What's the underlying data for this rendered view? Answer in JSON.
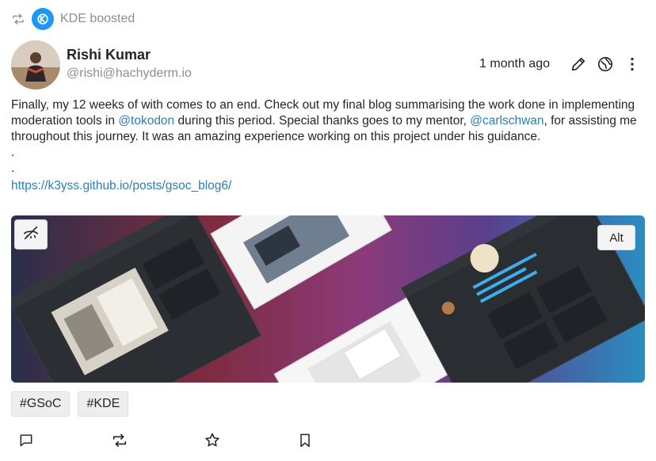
{
  "boost": {
    "label": "KDE boosted",
    "icon": "boost-icon",
    "account_logo": "kde-logo"
  },
  "author": {
    "name": "Rishi Kumar",
    "handle": "@rishi@hachyderm.io",
    "avatar": "avatar"
  },
  "meta": {
    "timestamp": "1 month ago",
    "icons": [
      "edit-icon",
      "globe-icon",
      "more-options-icon"
    ]
  },
  "post": {
    "text_1": "Finally, my 12 weeks of with comes to an end. Check out my final blog summarising the work done in implementing moderation tools in ",
    "mention_1": "@tokodon",
    "text_2": " during this period. Special thanks goes to my mentor, ",
    "mention_2": "@carlschwan",
    "text_3": ", for assisting me throughout this journey. It was an amazing experience working on this project under his guidance.",
    "dot_1": ".",
    "dot_2": ".",
    "link": "https://k3yss.github.io/posts/gsoc_blog6/"
  },
  "media": {
    "alt_label": "Alt",
    "hide_icon": "eye-hidden-icon"
  },
  "tags": [
    "#GSoC",
    "#KDE"
  ],
  "actions": [
    "reply-icon",
    "boost-icon",
    "favorite-icon",
    "bookmark-icon"
  ],
  "colors": {
    "link": "#2a7fb4",
    "secondary_text": "#8a8f94",
    "kde_blue": "#1d99f3"
  }
}
